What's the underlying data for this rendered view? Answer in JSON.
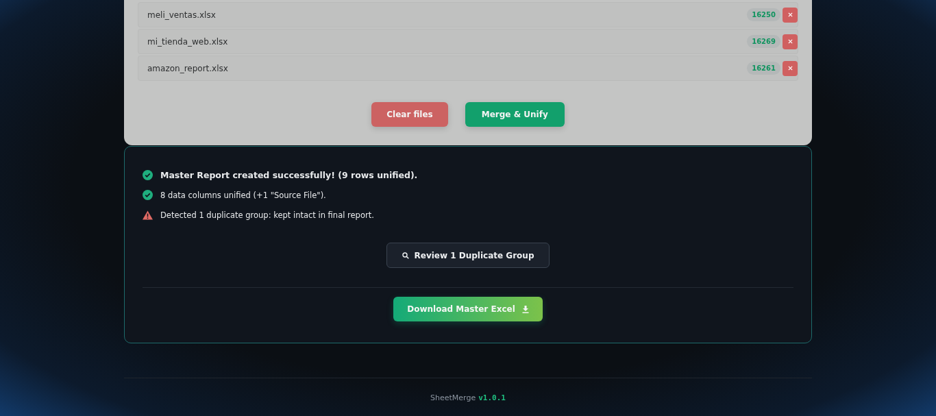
{
  "files": [
    {
      "name": "meli_ventas.xlsx",
      "count": "16250"
    },
    {
      "name": "mi_tienda_web.xlsx",
      "count": "16269"
    },
    {
      "name": "amazon_report.xlsx",
      "count": "16261"
    }
  ],
  "actions": [
    {
      "label": "Clear files",
      "kind": "danger"
    },
    {
      "label": "Merge & Unify",
      "kind": "primary"
    }
  ],
  "messages": [
    {
      "kind": "success",
      "text": "Master Report created successfully! (9 rows unified).",
      "bold": true
    },
    {
      "kind": "success",
      "text": "8 data columns unified (+1 \"Source File\").",
      "bold": false
    },
    {
      "kind": "warning",
      "text": "Detected 1 duplicate group: kept intact in final report.",
      "bold": false
    }
  ],
  "review_button": "Review 1 Duplicate Group",
  "download_button": "Download Master Excel",
  "footer": {
    "app": "SheetMerge",
    "version": "v1.0.1"
  }
}
